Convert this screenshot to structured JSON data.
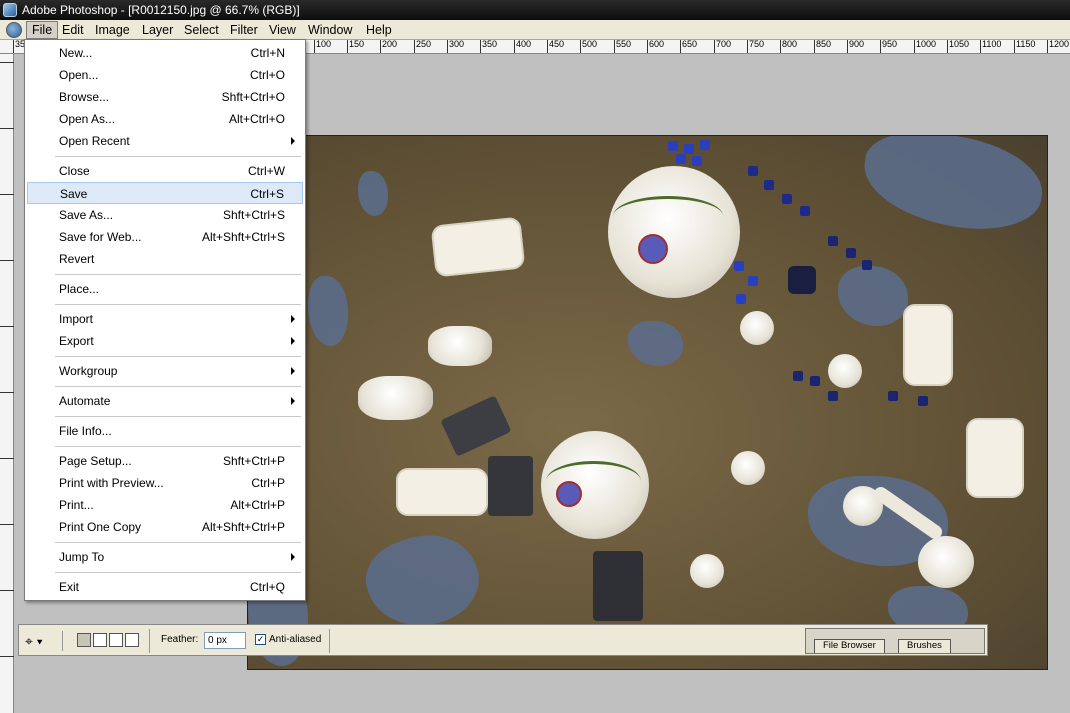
{
  "window": {
    "title": "Adobe Photoshop - [R0012150.jpg @ 66.7% (RGB)]"
  },
  "menubar": {
    "items": [
      "File",
      "Edit",
      "Image",
      "Layer",
      "Select",
      "Filter",
      "View",
      "Window",
      "Help"
    ],
    "active": "File"
  },
  "ruler": {
    "top_labels": [
      "35",
      "100",
      "150",
      "200",
      "250",
      "300",
      "350",
      "400",
      "450",
      "500",
      "550",
      "600",
      "650",
      "700",
      "750",
      "800",
      "850",
      "900",
      "950",
      "1000",
      "1050",
      "1100",
      "1150",
      "1200"
    ]
  },
  "file_menu": {
    "groups": [
      [
        {
          "label": "New...",
          "shortcut": "Ctrl+N"
        },
        {
          "label": "Open...",
          "shortcut": "Ctrl+O"
        },
        {
          "label": "Browse...",
          "shortcut": "Shft+Ctrl+O"
        },
        {
          "label": "Open As...",
          "shortcut": "Alt+Ctrl+O"
        },
        {
          "label": "Open Recent",
          "submenu": true
        }
      ],
      [
        {
          "label": "Close",
          "shortcut": "Ctrl+W"
        },
        {
          "label": "Save",
          "shortcut": "Ctrl+S",
          "highlighted": true
        },
        {
          "label": "Save As...",
          "shortcut": "Shft+Ctrl+S"
        },
        {
          "label": "Save for Web...",
          "shortcut": "Alt+Shft+Ctrl+S"
        },
        {
          "label": "Revert"
        }
      ],
      [
        {
          "label": "Place..."
        }
      ],
      [
        {
          "label": "Import",
          "submenu": true
        },
        {
          "label": "Export",
          "submenu": true
        }
      ],
      [
        {
          "label": "Workgroup",
          "submenu": true
        }
      ],
      [
        {
          "label": "Automate",
          "submenu": true
        }
      ],
      [
        {
          "label": "File Info..."
        }
      ],
      [
        {
          "label": "Page Setup...",
          "shortcut": "Shft+Ctrl+P"
        },
        {
          "label": "Print with Preview...",
          "shortcut": "Ctrl+P"
        },
        {
          "label": "Print...",
          "shortcut": "Alt+Ctrl+P"
        },
        {
          "label": "Print One Copy",
          "shortcut": "Alt+Shft+Ctrl+P"
        }
      ],
      [
        {
          "label": "Jump To",
          "submenu": true
        }
      ],
      [
        {
          "label": "Exit",
          "shortcut": "Ctrl+Q"
        }
      ]
    ]
  },
  "options_bar": {
    "feather_label": "Feather:",
    "feather_value": "0 px",
    "anti_aliased_label": "Anti-aliased",
    "anti_aliased_checked": true,
    "palette_tabs": [
      "File Browser",
      "Brushes"
    ]
  },
  "colors": {
    "menu_highlight": "#dde9f7",
    "titlebar": "#111111",
    "workspace": "#c0c0c0"
  }
}
